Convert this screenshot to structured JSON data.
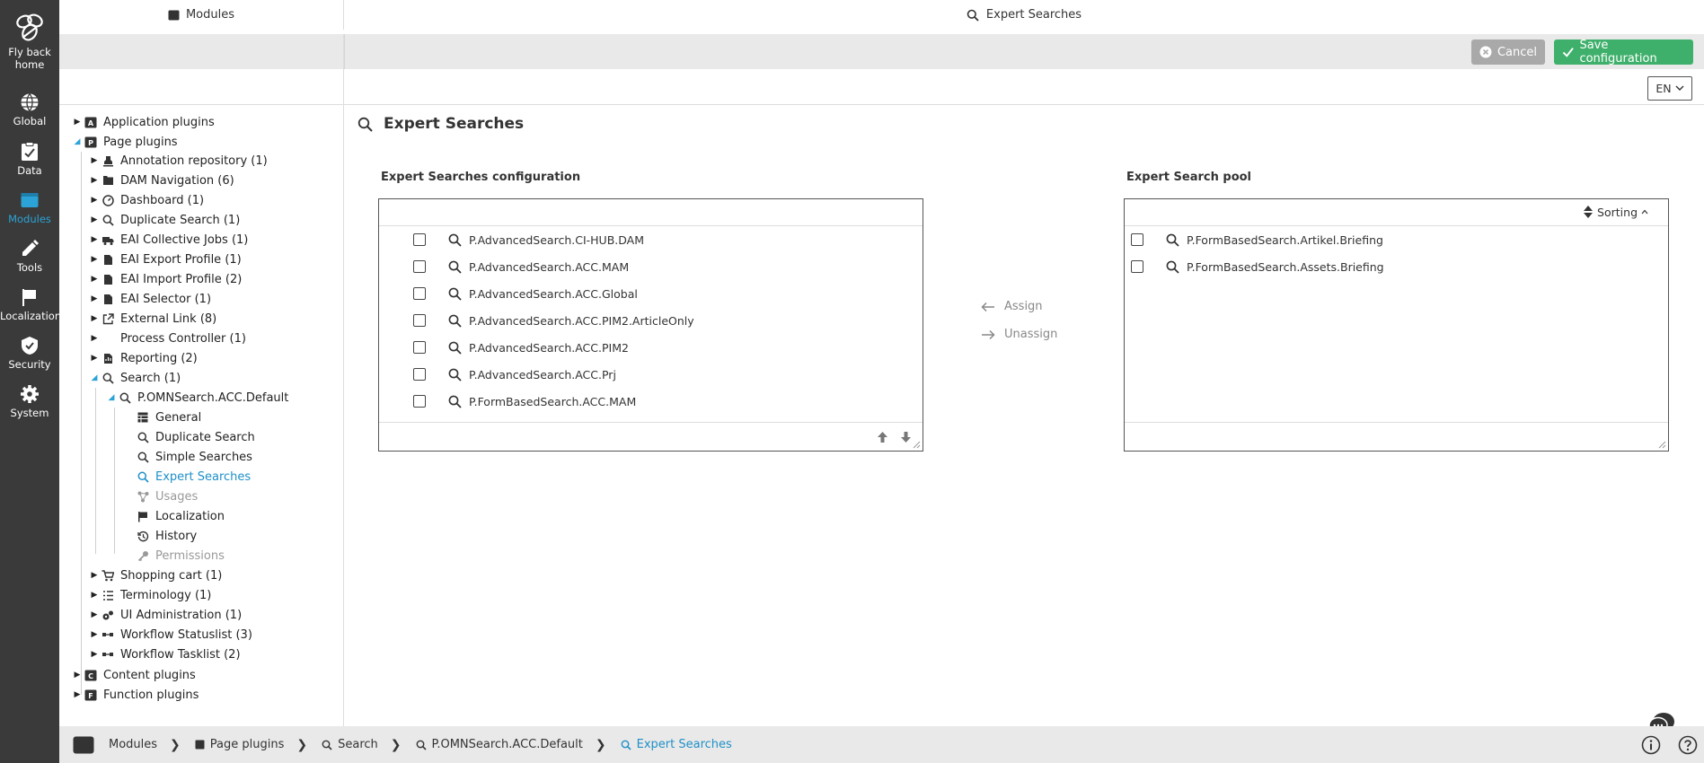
{
  "rail": {
    "home_label_1": "Fly back",
    "home_label_2": "home",
    "items": [
      {
        "label": "Global",
        "icon": "globe-icon"
      },
      {
        "label": "Data",
        "icon": "data-icon"
      },
      {
        "label": "Modules",
        "icon": "modules-icon",
        "active": true
      },
      {
        "label": "Tools",
        "icon": "tools-icon"
      },
      {
        "label": "Localization",
        "icon": "flag-icon"
      },
      {
        "label": "Security",
        "icon": "shield-icon"
      },
      {
        "label": "System",
        "icon": "gear-icon"
      }
    ]
  },
  "header": {
    "left_title": "Modules",
    "main_title": "Expert Searches"
  },
  "toolbar": {
    "cancel_label": "Cancel",
    "save_label": "Save configuration"
  },
  "language": {
    "selected": "EN"
  },
  "tree": {
    "application_plugins": "Application plugins",
    "page_plugins": "Page plugins",
    "children": [
      "Annotation repository (1)",
      "DAM Navigation (6)",
      "Dashboard (1)",
      "Duplicate Search (1)",
      "EAI Collective Jobs (1)",
      "EAI Export Profile (1)",
      "EAI Import Profile (2)",
      "EAI Selector (1)",
      "External Link (8)",
      "Process Controller (1)",
      "Reporting (2)"
    ],
    "search": "Search (1)",
    "search_child": "P.OMNSearch.ACC.Default",
    "search_sub": [
      {
        "label": "General",
        "state": "normal"
      },
      {
        "label": "Duplicate Search",
        "state": "normal"
      },
      {
        "label": "Simple Searches",
        "state": "normal"
      },
      {
        "label": "Expert Searches",
        "state": "selected"
      },
      {
        "label": "Usages",
        "state": "disabled"
      },
      {
        "label": "Localization",
        "state": "normal"
      },
      {
        "label": "History",
        "state": "normal"
      },
      {
        "label": "Permissions",
        "state": "disabled"
      }
    ],
    "children_after": [
      "Shopping cart (1)",
      "Terminology (1)",
      "UI Administration (1)",
      "Workflow Statuslist (3)",
      "Workflow Tasklist (2)"
    ],
    "content_plugins": "Content plugins",
    "function_plugins": "Function plugins"
  },
  "content": {
    "title": "Expert Searches",
    "config_title": "Expert Searches configuration",
    "pool_title": "Expert Search pool",
    "config_items": [
      "P.AdvancedSearch.CI-HUB.DAM",
      "P.AdvancedSearch.ACC.MAM",
      "P.AdvancedSearch.ACC.Global",
      "P.AdvancedSearch.ACC.PIM2.ArticleOnly",
      "P.AdvancedSearch.ACC.PIM2",
      "P.AdvancedSearch.ACC.Prj",
      "P.FormBasedSearch.ACC.MAM"
    ],
    "pool_items": [
      "P.FormBasedSearch.Artikel.Briefing",
      "P.FormBasedSearch.Assets.Briefing"
    ],
    "sorting_label": "Sorting",
    "assign_label": "Assign",
    "unassign_label": "Unassign"
  },
  "breadcrumb": {
    "items": [
      "Modules",
      "Page plugins",
      "Search",
      "P.OMNSearch.ACC.Default",
      "Expert Searches"
    ]
  },
  "colors": {
    "rail_bg": "#3a3a3a",
    "accent": "#2ba3d6",
    "save_green": "#3fb06b",
    "cancel_gray": "#a9a9a9"
  }
}
